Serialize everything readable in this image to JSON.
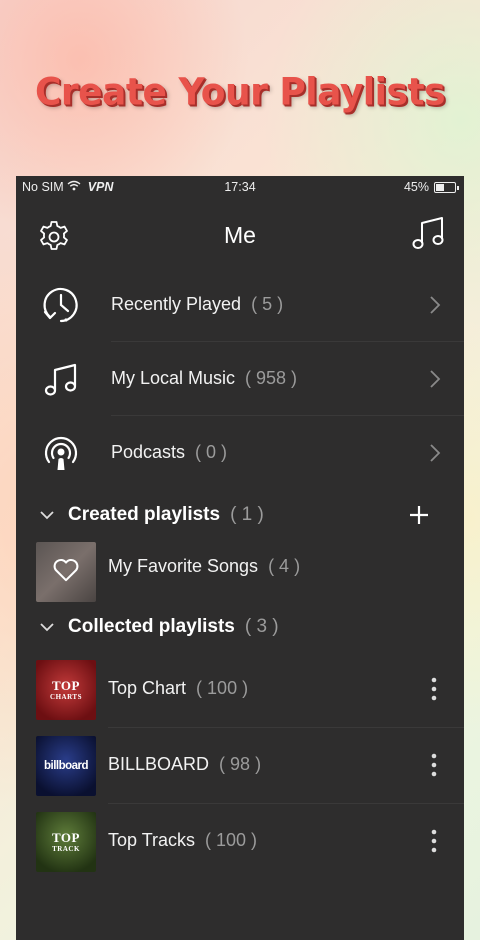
{
  "banner": {
    "headline": "Create Your Playlists"
  },
  "status_bar": {
    "carrier": "No SIM",
    "vpn": "VPN",
    "time": "17:34",
    "battery": "45%",
    "battery_level": 0.45
  },
  "header": {
    "title": "Me"
  },
  "menu": [
    {
      "label": "Recently Played",
      "count": "( 5 )",
      "icon": "recent-history-icon"
    },
    {
      "label": "My Local Music",
      "count": "( 958 )",
      "icon": "music-note-icon"
    },
    {
      "label": "Podcasts",
      "count": "( 0 )",
      "icon": "podcast-icon"
    }
  ],
  "created": {
    "title": "Created playlists",
    "count": "( 1 )",
    "items": [
      {
        "label": "My Favorite Songs",
        "count": "( 4 )"
      }
    ]
  },
  "collected": {
    "title": "Collected playlists",
    "count": "( 3 )",
    "items": [
      {
        "label": "Top Chart",
        "count": "( 100 )",
        "cover_line1": "TOP",
        "cover_line2": "CHARTS"
      },
      {
        "label": "BILLBOARD",
        "count": "( 98 )",
        "cover_line1": "billboard"
      },
      {
        "label": "Top Tracks",
        "count": "( 100 )",
        "cover_line1": "TOP",
        "cover_line2": "TRACK"
      }
    ]
  },
  "colors": {
    "background": "#2e2d2d",
    "headline": "#e8534b",
    "count_text": "#9b9b9b"
  }
}
